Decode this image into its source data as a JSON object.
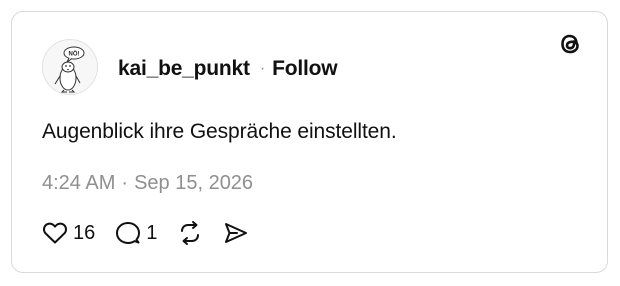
{
  "post": {
    "username": "kai_be_punkt",
    "separator": "·",
    "follow_label": "Follow",
    "text": "Augenblick ihre Gespräche einstellten.",
    "time": "4:24 AM",
    "meta_separator": "·",
    "date": "Sep 15, 2026",
    "avatar_badge": "NÖ!"
  },
  "actions": {
    "like_count": "16",
    "reply_count": "1"
  },
  "icons": {
    "brand": "threads-logo-icon",
    "like": "heart-icon",
    "reply": "speech-bubble-icon",
    "repost": "repost-icon",
    "share": "send-icon"
  },
  "colors": {
    "text": "#111111",
    "muted": "#8f8f8f",
    "border": "#d9d9d9"
  }
}
